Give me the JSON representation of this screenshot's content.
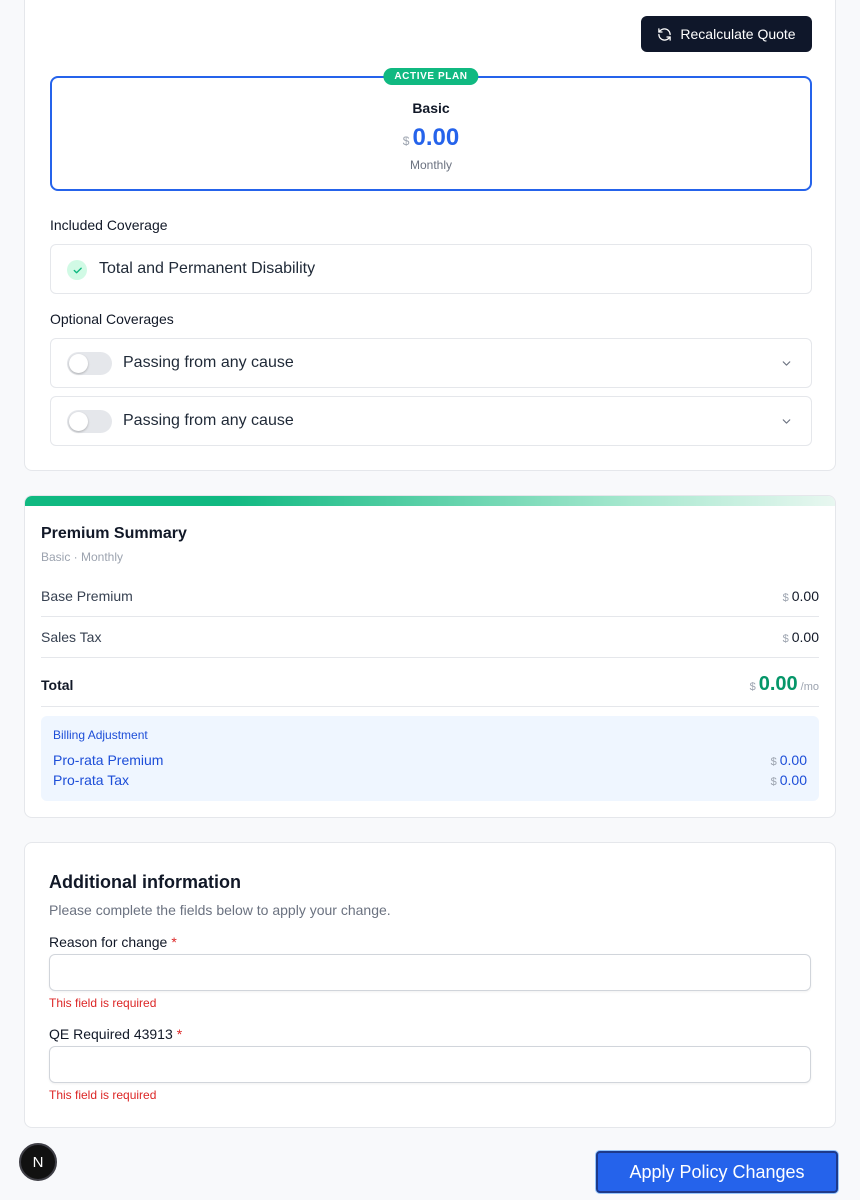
{
  "plan_card": {
    "recalculate_label": "Recalculate Quote",
    "plan": {
      "badge": "ACTIVE PLAN",
      "name": "Basic",
      "currency": "$",
      "amount": "0.00",
      "frequency": "Monthly"
    },
    "included_label": "Included Coverage",
    "included": [
      {
        "label": "Total and Permanent Disability"
      }
    ],
    "optional_label": "Optional Coverages",
    "optional": [
      {
        "label": "Passing from any cause",
        "enabled": false
      },
      {
        "label": "Passing from any cause",
        "enabled": false
      }
    ]
  },
  "summary": {
    "title": "Premium Summary",
    "subtitle": "Basic · Monthly",
    "rows": [
      {
        "label": "Base Premium",
        "currency": "$",
        "value": "0.00"
      },
      {
        "label": "Sales Tax",
        "currency": "$",
        "value": "0.00"
      }
    ],
    "total": {
      "label": "Total",
      "currency": "$",
      "value": "0.00",
      "period": "/mo"
    },
    "billing": {
      "title": "Billing Adjustment",
      "rows": [
        {
          "label": "Pro-rata Premium",
          "currency": "$",
          "value": "0.00"
        },
        {
          "label": "Pro-rata Tax",
          "currency": "$",
          "value": "0.00"
        }
      ]
    }
  },
  "info": {
    "title": "Additional information",
    "description": "Please complete the fields below to apply your change.",
    "fields": [
      {
        "label": "Reason for change",
        "required_mark": "*",
        "value": "",
        "error": "This field is required"
      },
      {
        "label": "QE Required 43913",
        "required_mark": "*",
        "value": "",
        "error": "This field is required"
      }
    ]
  },
  "footer": {
    "badge_letter": "N",
    "apply_label": "Apply Policy Changes"
  },
  "colors": {
    "accent": "#2563eb",
    "success": "#10b981",
    "error": "#dc2626",
    "dark_button": "#0f172a"
  }
}
